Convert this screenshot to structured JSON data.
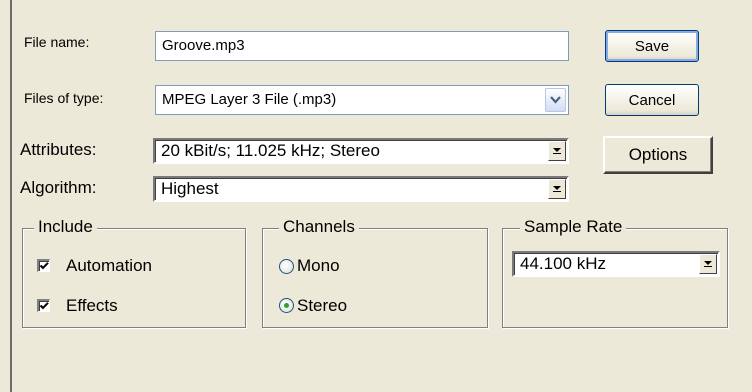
{
  "form": {
    "file_name_label": "File name:",
    "file_name_value": "Groove.mp3",
    "files_of_type_label": "Files of type:",
    "files_of_type_value": "MPEG Layer 3 File (.mp3)",
    "attributes_label": "Attributes:",
    "attributes_value": "20 kBit/s; 11.025 kHz; Stereo",
    "algorithm_label": "Algorithm:",
    "algorithm_value": "Highest"
  },
  "buttons": {
    "save": "Save",
    "cancel": "Cancel",
    "options": "Options"
  },
  "include": {
    "title": "Include",
    "automation": {
      "label": "Automation",
      "checked": true
    },
    "effects": {
      "label": "Effects",
      "checked": true
    }
  },
  "channels": {
    "title": "Channels",
    "mono": {
      "label": "Mono",
      "selected": false
    },
    "stereo": {
      "label": "Stereo",
      "selected": true
    }
  },
  "sample_rate": {
    "title": "Sample Rate",
    "value": "44.100 kHz"
  },
  "colors": {
    "background": "#ece9d8",
    "radio_dot": "#31a12c",
    "xp_border": "#7f9db9"
  }
}
